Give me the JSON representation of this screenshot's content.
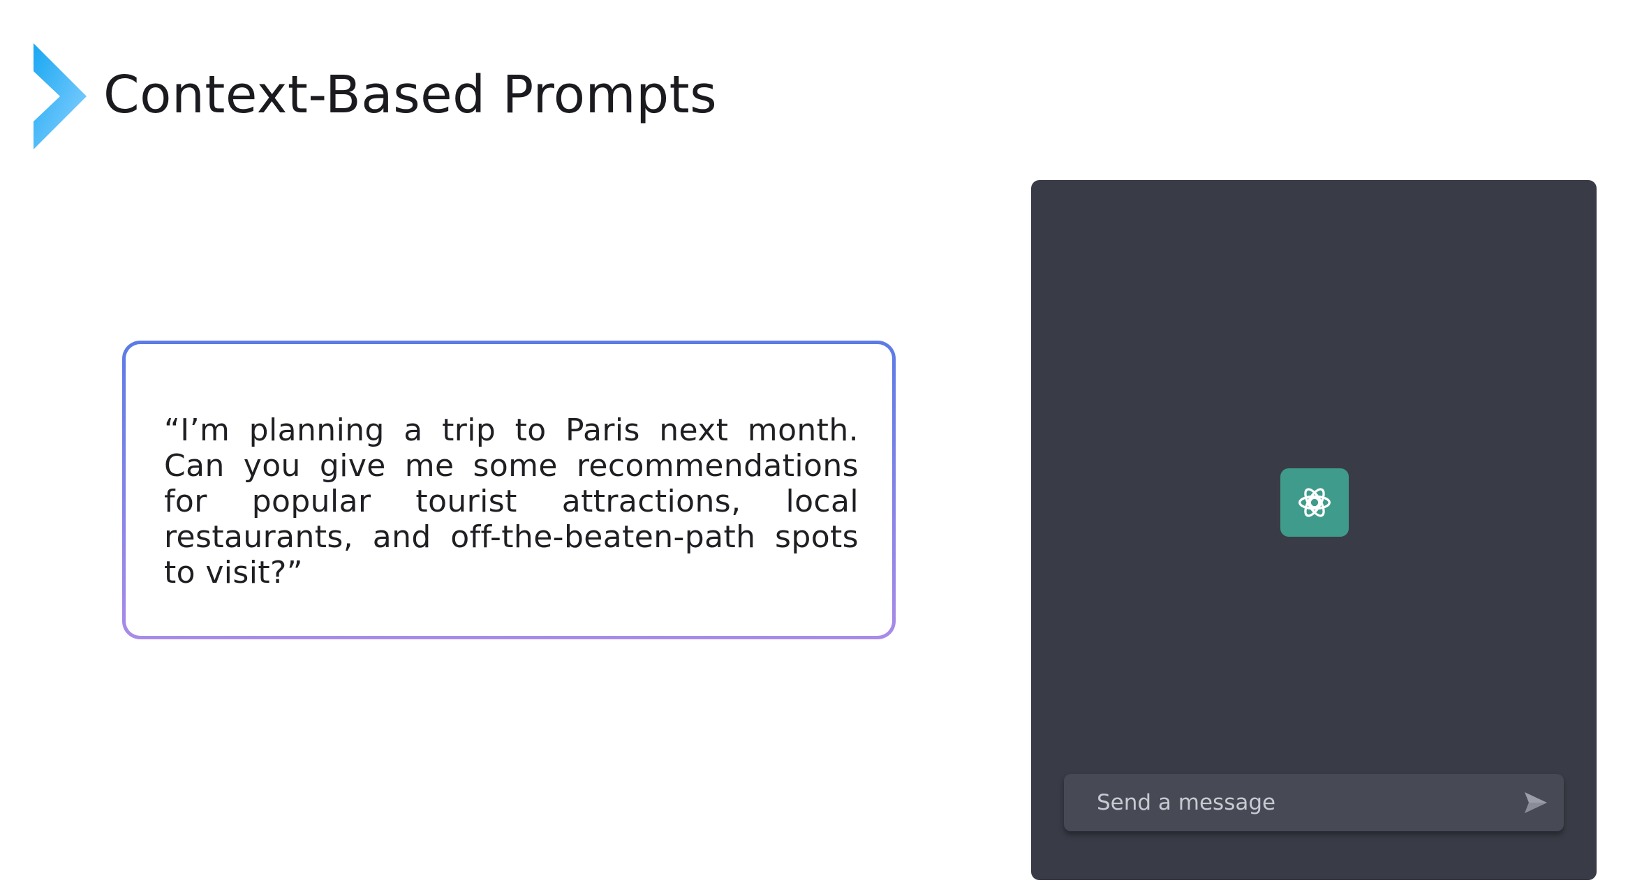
{
  "header": {
    "title": "Context-Based Prompts",
    "accent_icon": "chevron-right-icon"
  },
  "prompt_card": {
    "text": "“I’m planning a trip to Paris next month. Can you give me some recommendations for popular tourist attractions, local restaurants, and off-the-beaten-path spots to visit?”"
  },
  "chat": {
    "logo_icon": "openai-logo-icon",
    "input_placeholder": "Send a message",
    "send_icon": "send-icon"
  },
  "colors": {
    "chevron_gradient_start": "#1ea0f0",
    "chevron_gradient_end": "#7fd1ff",
    "card_border_top": "#5b7be6",
    "card_border_bottom": "#a98be8",
    "chat_background": "#393b46",
    "logo_tile": "#3f9b8b",
    "message_bar": "#474954"
  }
}
